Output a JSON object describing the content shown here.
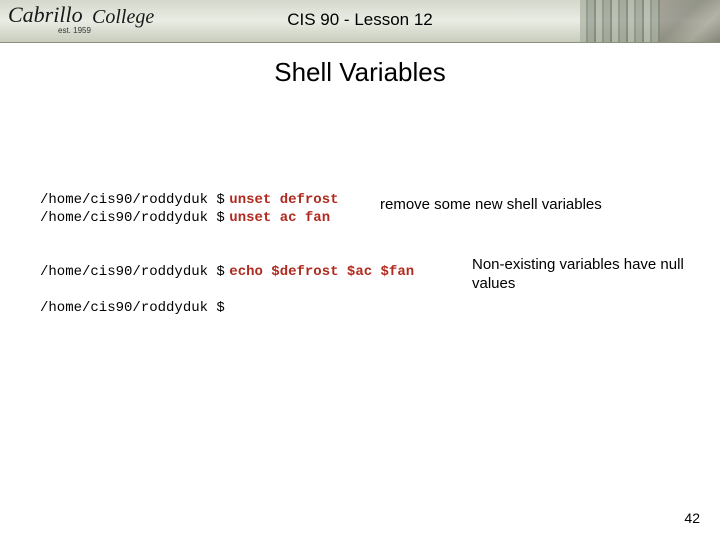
{
  "banner": {
    "logo_script": "Cabrillo",
    "logo_college": "College",
    "est": "est. 1959",
    "course_title": "CIS 90 - Lesson 12"
  },
  "heading": "Shell Variables",
  "terminal": {
    "prompt": "/home/cis90/roddyduk $",
    "lines": {
      "l1_cmd": "unset defrost",
      "l2_cmd": "unset ac fan",
      "l3_cmd": "echo $defrost $ac $fan"
    }
  },
  "annotations": {
    "a1": "remove some new shell variables",
    "a2": "Non-existing variables have null values"
  },
  "page_number": "42"
}
